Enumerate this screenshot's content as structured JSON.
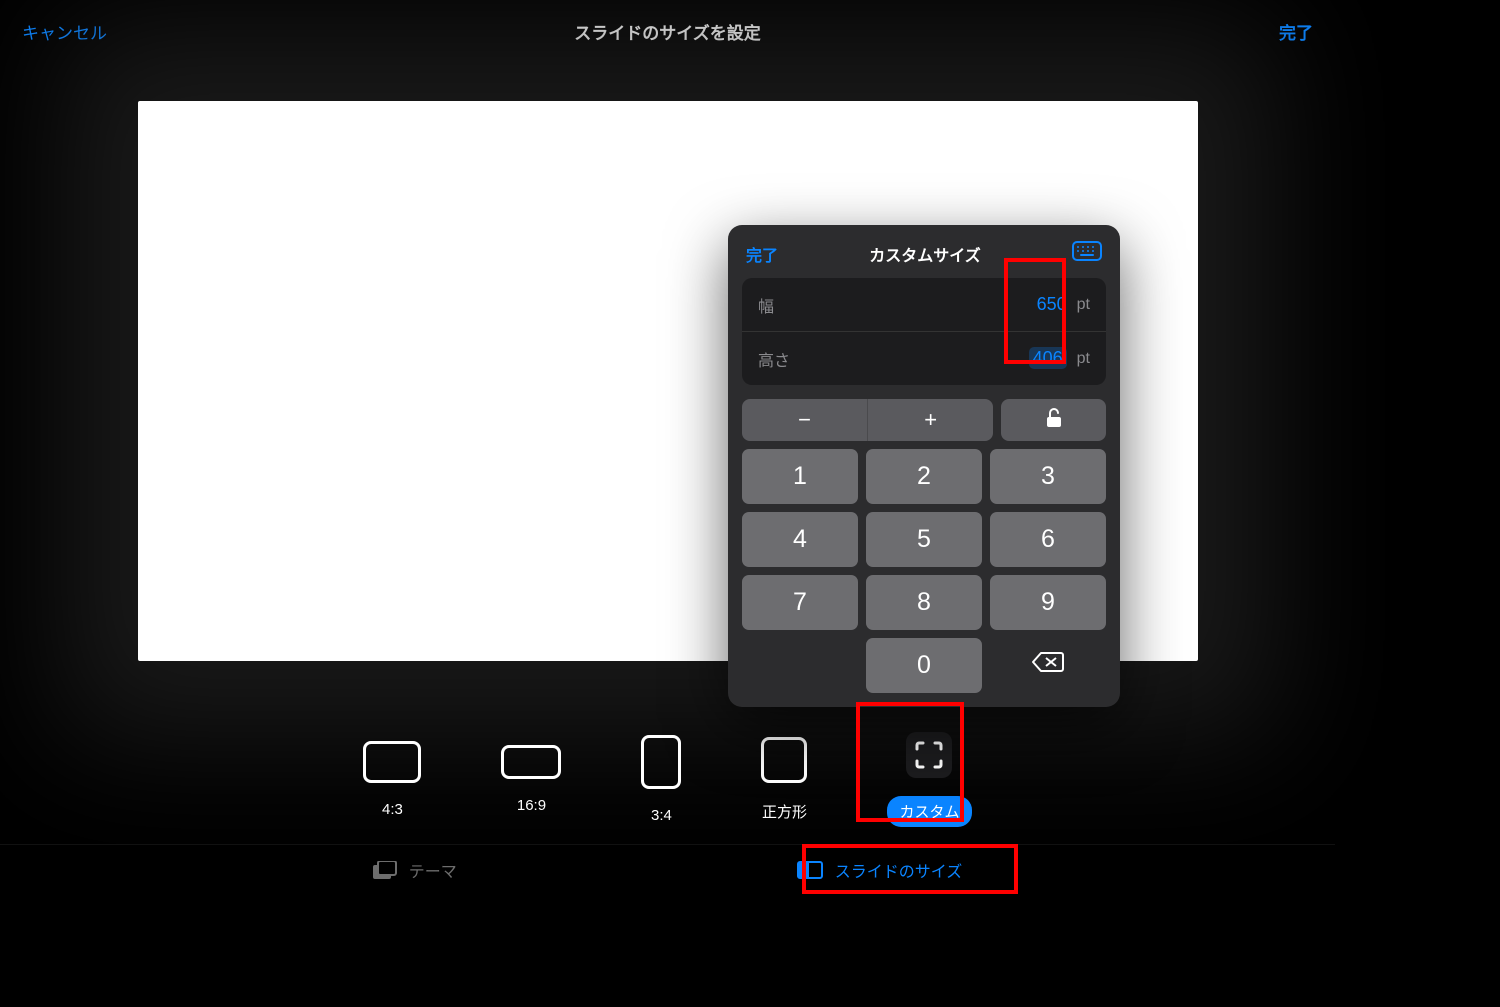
{
  "header": {
    "cancel": "キャンセル",
    "title": "スライドのサイズを設定",
    "done": "完了"
  },
  "ratios": {
    "r43": "4:3",
    "r169": "16:9",
    "r34": "3:4",
    "square": "正方形",
    "custom": "カスタム"
  },
  "popover": {
    "done": "完了",
    "title": "カスタムサイズ",
    "width_label": "幅",
    "height_label": "高さ",
    "width_value": "650",
    "height_value": "406",
    "unit": "pt",
    "keys": {
      "1": "1",
      "2": "2",
      "3": "3",
      "4": "4",
      "5": "5",
      "6": "6",
      "7": "7",
      "8": "8",
      "9": "9",
      "0": "0",
      "minus": "−",
      "plus": "+"
    }
  },
  "bottom": {
    "theme": "テーマ",
    "slide_size": "スライドのサイズ"
  }
}
